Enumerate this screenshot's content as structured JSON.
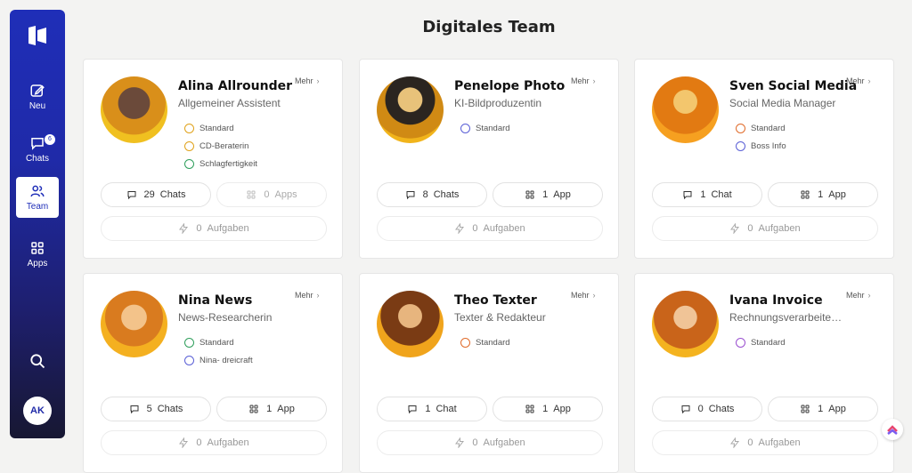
{
  "sidebar": {
    "items": [
      {
        "label": "Neu",
        "icon": "edit-icon"
      },
      {
        "label": "Chats",
        "icon": "chat-icon",
        "badge": "6"
      },
      {
        "label": "Team",
        "icon": "team-icon",
        "active": true
      },
      {
        "label": "Apps",
        "icon": "apps-icon"
      }
    ],
    "avatar_initials": "AK"
  },
  "header": {
    "title": "Digitales Team"
  },
  "cards": [
    {
      "name": "Alina Allrounder",
      "role": "Allgemeiner Assistent",
      "more": "Mehr",
      "skills": [
        {
          "label": "Standard",
          "color": "#e0a21a"
        },
        {
          "label": "CD-Beraterin",
          "color": "#e0a21a"
        },
        {
          "label": "Schlagfertigkeit",
          "color": "#2e9e5b"
        }
      ],
      "chats_count": "29",
      "chats_label": "Chats",
      "apps_count": "0",
      "apps_label": "Apps",
      "apps_disabled": true,
      "tasks_count": "0",
      "tasks_label": "Aufgaben"
    },
    {
      "name": "Penelope Photo",
      "role": "KI-Bildproduzentin",
      "more": "Mehr",
      "skills": [
        {
          "label": "Standard",
          "color": "#5a5fd6"
        }
      ],
      "chats_count": "8",
      "chats_label": "Chats",
      "apps_count": "1",
      "apps_label": "App",
      "tasks_count": "0",
      "tasks_label": "Aufgaben"
    },
    {
      "name": "Sven Social Media",
      "role": "Social Media Manager",
      "more": "Mehr",
      "skills": [
        {
          "label": "Standard",
          "color": "#e06b2a"
        },
        {
          "label": "Boss Info",
          "color": "#5a5fd6"
        }
      ],
      "chats_count": "1",
      "chats_label": "Chat",
      "apps_count": "1",
      "apps_label": "App",
      "tasks_count": "0",
      "tasks_label": "Aufgaben"
    },
    {
      "name": "Nina News",
      "role": "News-Researcherin",
      "more": "Mehr",
      "skills": [
        {
          "label": "Standard",
          "color": "#2e9e5b"
        },
        {
          "label": "Nina- dreicraft",
          "color": "#5a5fd6"
        }
      ],
      "chats_count": "5",
      "chats_label": "Chats",
      "apps_count": "1",
      "apps_label": "App",
      "tasks_count": "0",
      "tasks_label": "Aufgaben"
    },
    {
      "name": "Theo Texter",
      "role": "Texter & Redakteur",
      "more": "Mehr",
      "skills": [
        {
          "label": "Standard",
          "color": "#e06b2a"
        }
      ],
      "chats_count": "1",
      "chats_label": "Chat",
      "apps_count": "1",
      "apps_label": "App",
      "tasks_count": "0",
      "tasks_label": "Aufgaben"
    },
    {
      "name": "Ivana Invoice",
      "role": "Rechnungsverarbeite…",
      "more": "Mehr",
      "skills": [
        {
          "label": "Standard",
          "color": "#9a4fd0"
        }
      ],
      "chats_count": "0",
      "chats_label": "Chats",
      "apps_count": "1",
      "apps_label": "App",
      "tasks_count": "0",
      "tasks_label": "Aufgaben"
    }
  ]
}
